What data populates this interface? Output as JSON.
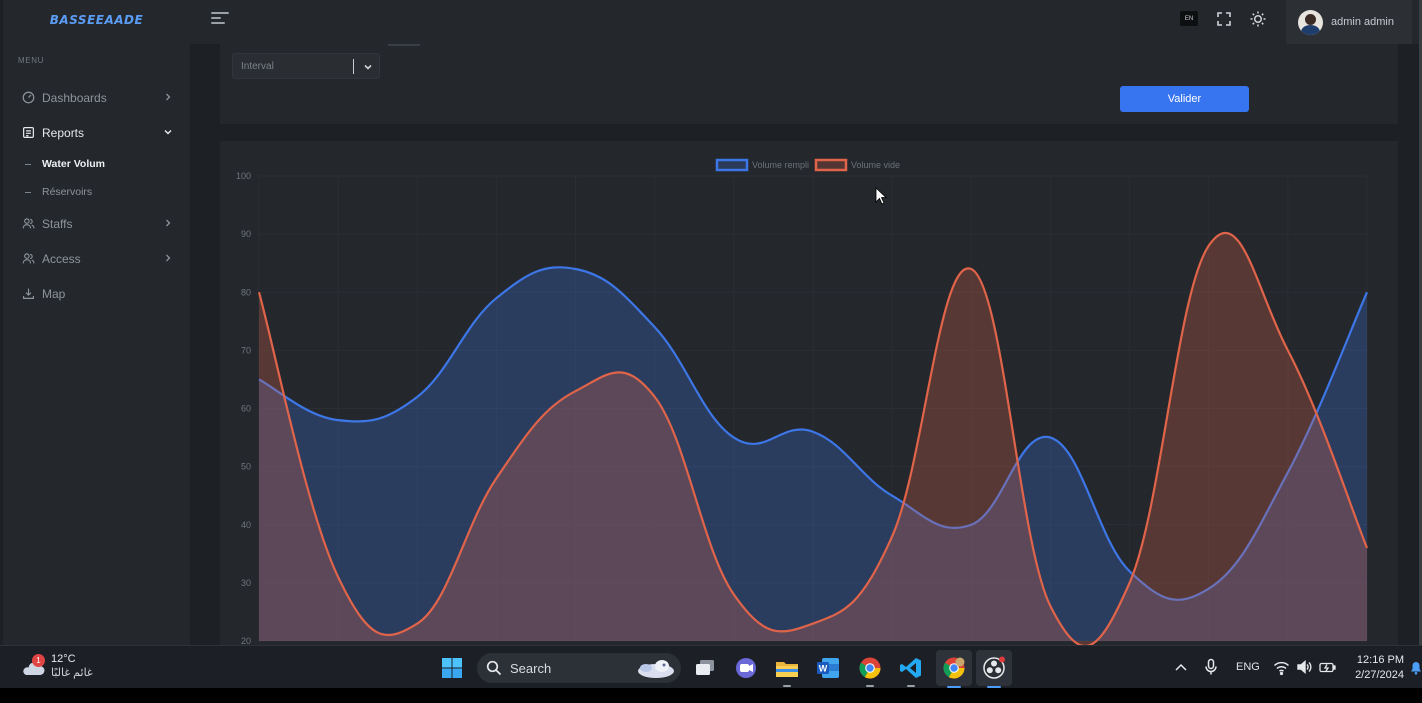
{
  "app": {
    "brand": "BASSEEAADE",
    "user_name": "admin admin",
    "lang_badge": "EN"
  },
  "sidebar": {
    "menu_title": "MENU",
    "items": [
      {
        "label": "Dashboards",
        "icon": "dashboard-icon",
        "expanded": false
      },
      {
        "label": "Reports",
        "icon": "reports-icon",
        "expanded": true,
        "children": [
          {
            "label": "Water Volum",
            "active": true
          },
          {
            "label": "Réservoirs",
            "active": false
          }
        ]
      },
      {
        "label": "Staffs",
        "icon": "users-icon",
        "expanded": false
      },
      {
        "label": "Access",
        "icon": "access-icon",
        "expanded": false
      },
      {
        "label": "Map",
        "icon": "map-pin-icon",
        "expanded": false
      }
    ]
  },
  "filters": {
    "interval_placeholder": "Interval",
    "submit_label": "Valider"
  },
  "colors": {
    "accent": "#3674f0",
    "series_filled": "#3d76e6",
    "series_empty": "#e0644a"
  },
  "chart_data": {
    "type": "area",
    "y_ticks": [
      "100",
      "90",
      "80",
      "70",
      "60",
      "50",
      "40",
      "30",
      "20"
    ],
    "ylim": [
      20,
      100
    ],
    "legend_position": "top-center",
    "grid": true,
    "series": [
      {
        "name": "Volume rempli",
        "color": "#3d76e6",
        "values": [
          65,
          58,
          62,
          79,
          84,
          74,
          55,
          56,
          45,
          40,
          55,
          32,
          29,
          49,
          80
        ]
      },
      {
        "name": "Volume vide",
        "color": "#e0644a",
        "values": [
          80,
          31,
          23,
          48,
          63,
          62,
          28,
          23,
          38,
          84,
          26,
          30,
          88,
          70,
          36
        ]
      }
    ]
  },
  "taskbar": {
    "weather_temp": "12°C",
    "weather_cond": "غائم غالبًا",
    "weather_badge": "1",
    "search_label": "Search",
    "lang": "ENG",
    "time": "12:16 PM",
    "date": "2/27/2024"
  }
}
